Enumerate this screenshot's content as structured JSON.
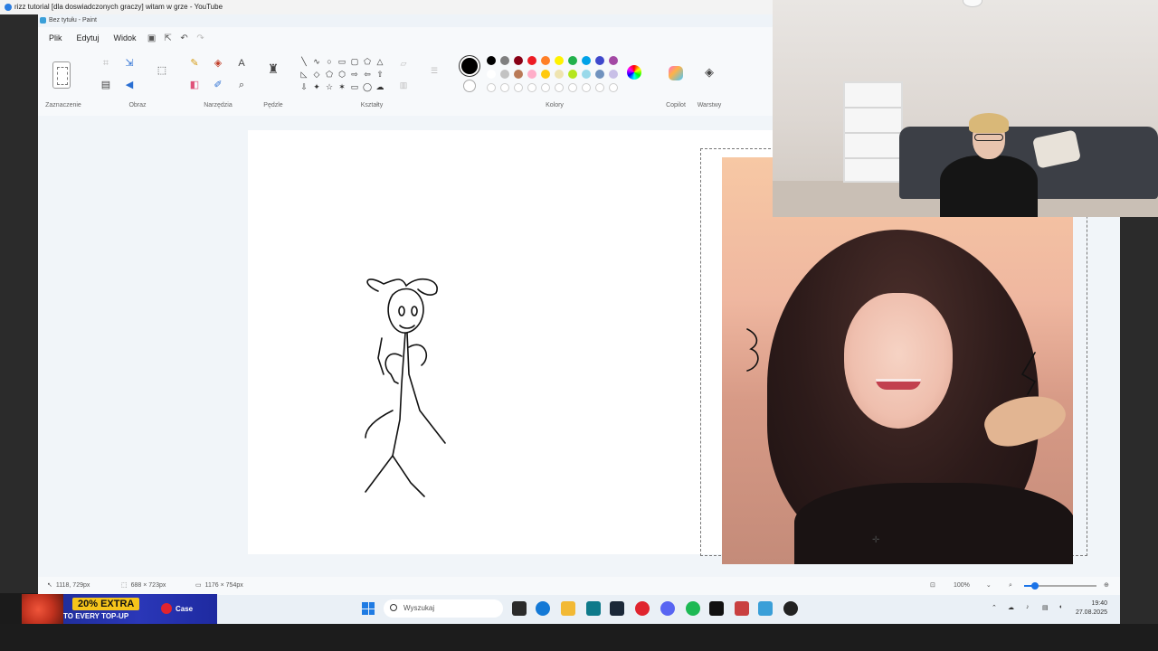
{
  "window": {
    "title": "rizz tutorial [dla doswiadczonych graczy] witam w grze - YouTube"
  },
  "paint": {
    "title": "Bez tytułu - Paint",
    "menu": [
      "Plik",
      "Edytuj",
      "Widok"
    ],
    "groups": {
      "selection": "Zaznaczenie",
      "image": "Obraz",
      "tools": "Narzędzia",
      "brushes": "Pędzle",
      "shapes": "Kształty",
      "colors": "Kolory",
      "copilot": "Copilot",
      "layers": "Warstwy"
    },
    "colors": {
      "active": "#000000",
      "palette_row1": [
        "#000000",
        "#7f7f7f",
        "#880015",
        "#ed1c24",
        "#ff7f27",
        "#fff200",
        "#22b14c",
        "#00a2e8",
        "#3f48cc",
        "#a349a4"
      ],
      "palette_row2": [
        "#ffffff",
        "#c3c3c3",
        "#b97a57",
        "#ffaec9",
        "#ffc90e",
        "#efe4b0",
        "#b5e61d",
        "#99d9ea",
        "#7092be",
        "#c8bfe7"
      ]
    },
    "status": {
      "cursor": "1118, 729px",
      "selection_size": "688 × 723px",
      "canvas_size": "1176 × 754px",
      "zoom": "100%",
      "zoom_level": 0.15
    }
  },
  "taskbar": {
    "search_placeholder": "Wyszukaj",
    "time": "19:40",
    "date": "27.08.2025"
  },
  "promo": {
    "badge": "20% EXTRA",
    "sub": "TO EVERY TOP-UP",
    "brand": "Case"
  }
}
